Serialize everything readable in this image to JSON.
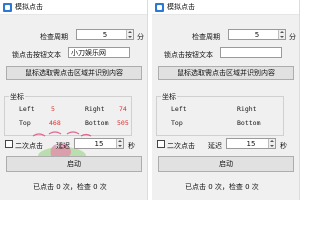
{
  "windows": [
    {
      "title": "模拟点击",
      "check_period_label": "检查周期",
      "check_period_value": "5",
      "check_period_unit": "分",
      "lock_text_label": "锁点击按钮文本",
      "lock_text_value": "小刀娱乐网",
      "select_button_label": "鼠标选取需点击区域并识别内容",
      "coords_group_title": "坐标",
      "left_label": "Left",
      "left_value": "5",
      "right_label": "Right",
      "right_value": "74",
      "top_label": "Top",
      "top_value": "468",
      "bottom_label": "Bottom",
      "bottom_value": "505",
      "double_click_label": "二次点击",
      "delay_label": "延迟",
      "delay_value": "15",
      "delay_unit": "秒",
      "start_button_label": "启动",
      "status_text": "已点击 0 次，检查 0 次",
      "watermark_text": "小刀娱乐网 xiaodaoyule"
    },
    {
      "title": "模拟点击",
      "check_period_label": "检查周期",
      "check_period_value": "5",
      "check_period_unit": "分",
      "lock_text_label": "锁点击按钮文本",
      "lock_text_value": "",
      "select_button_label": "鼠标选取需点击区域并识别内容",
      "coords_group_title": "坐标",
      "left_label": "Left",
      "left_value": "",
      "right_label": "Right",
      "right_value": "",
      "top_label": "Top",
      "top_value": "",
      "bottom_label": "Bottom",
      "bottom_value": "",
      "double_click_label": "二次点击",
      "delay_label": "延迟",
      "delay_value": "15",
      "delay_unit": "秒",
      "start_button_label": "启动",
      "status_text": "已点击 0 次，检查 0 次"
    }
  ],
  "colors": {
    "value_red": "#e03030",
    "watermark": "#d9457a"
  },
  "icons": {
    "app": "window-app-icon",
    "watermark": "watermark-logo"
  }
}
